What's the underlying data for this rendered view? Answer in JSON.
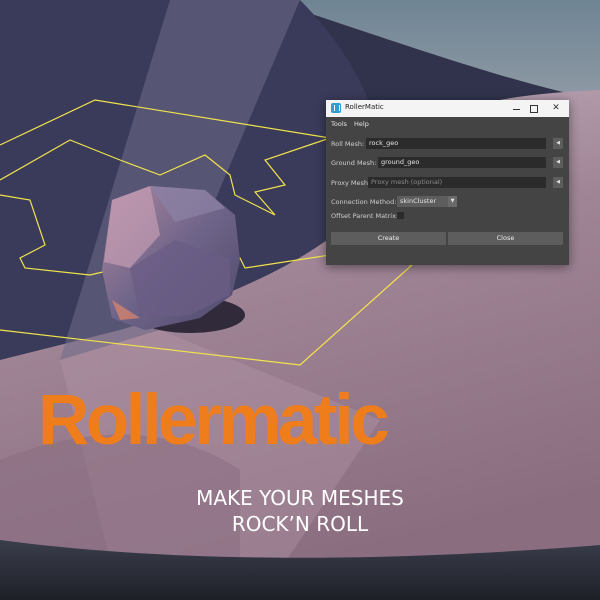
{
  "window": {
    "title": "RollerMatic",
    "controls": {
      "minimize_icon": "minimize-icon",
      "maximize_icon": "maximize-icon",
      "close_glyph": "✕"
    },
    "menu": [
      "Tools",
      "Help"
    ],
    "fields": {
      "roll_mesh": {
        "label": "Roll Mesh:",
        "value": "rock_geo",
        "button": "◀"
      },
      "ground_mesh": {
        "label": "Ground Mesh:",
        "value": "ground_geo",
        "button": "◀"
      },
      "proxy_mesh": {
        "label": "Proxy Mesh:",
        "value": "",
        "placeholder": "Proxy mesh (optional)",
        "button": "◀"
      }
    },
    "connection_method": {
      "label": "Connection Method:",
      "selected": "skinCluster",
      "arrow": "▼"
    },
    "offset_parent_matrix": {
      "label": "Offset Parent Matrix:",
      "checked": false
    },
    "buttons": {
      "create": "Create",
      "close": "Close"
    }
  },
  "headline": {
    "brand": "Rollermatic",
    "tagline_line1": "MAKE YOUR MESHES",
    "tagline_line2": "ROCK’N ROLL"
  },
  "colors": {
    "brand_orange": "#f07d1b",
    "wireframe_yellow": "#f1e34c",
    "window_bg": "#444444",
    "field_bg": "#2b2b2b"
  }
}
